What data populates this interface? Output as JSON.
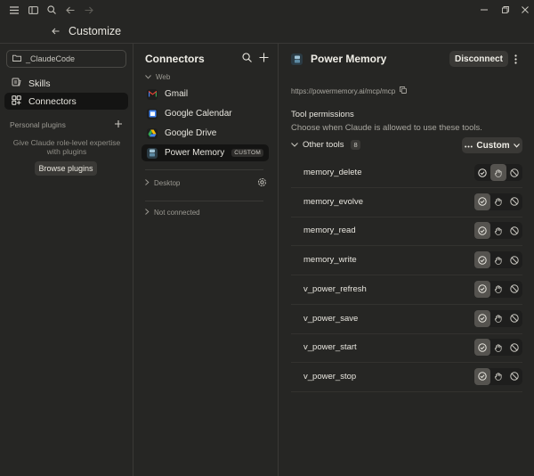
{
  "header": {
    "back_label": "Customize"
  },
  "sidebar": {
    "project": "_ClaudeCode",
    "items": [
      {
        "label": "Skills",
        "active": false
      },
      {
        "label": "Connectors",
        "active": true
      }
    ],
    "plugins": {
      "heading": "Personal plugins",
      "description": "Give Claude role-level expertise with plugins",
      "browse_label": "Browse plugins"
    }
  },
  "connectors": {
    "title": "Connectors",
    "web_group": "Web",
    "items": [
      {
        "label": "Gmail",
        "icon": "gmail-icon"
      },
      {
        "label": "Google Calendar",
        "icon": "google-calendar-icon"
      },
      {
        "label": "Google Drive",
        "icon": "google-drive-icon"
      },
      {
        "label": "Power Memory",
        "icon": "power-memory-icon",
        "badge": "CUSTOM",
        "active": true
      }
    ],
    "desktop_group": "Desktop",
    "not_connected_group": "Not connected"
  },
  "detail": {
    "title": "Power Memory",
    "disconnect_label": "Disconnect",
    "url": "https://powermemory.ai/mcp/mcp",
    "tool_permissions_title": "Tool permissions",
    "tool_permissions_sub": "Choose when Claude is allowed to use these tools.",
    "other_tools_label": "Other tools",
    "other_tools_count": "8",
    "custom_label": "Custom",
    "tools": [
      {
        "name": "memory_delete",
        "permission": "ask"
      },
      {
        "name": "memory_evolve",
        "permission": "allow"
      },
      {
        "name": "memory_read",
        "permission": "allow"
      },
      {
        "name": "memory_write",
        "permission": "allow"
      },
      {
        "name": "v_power_refresh",
        "permission": "allow"
      },
      {
        "name": "v_power_save",
        "permission": "allow"
      },
      {
        "name": "v_power_start",
        "permission": "allow"
      },
      {
        "name": "v_power_stop",
        "permission": "allow"
      }
    ]
  },
  "colors": {
    "background": "#262624",
    "active_item": "#141413",
    "button": "#3a3936",
    "selected_segment": "#55534f"
  }
}
